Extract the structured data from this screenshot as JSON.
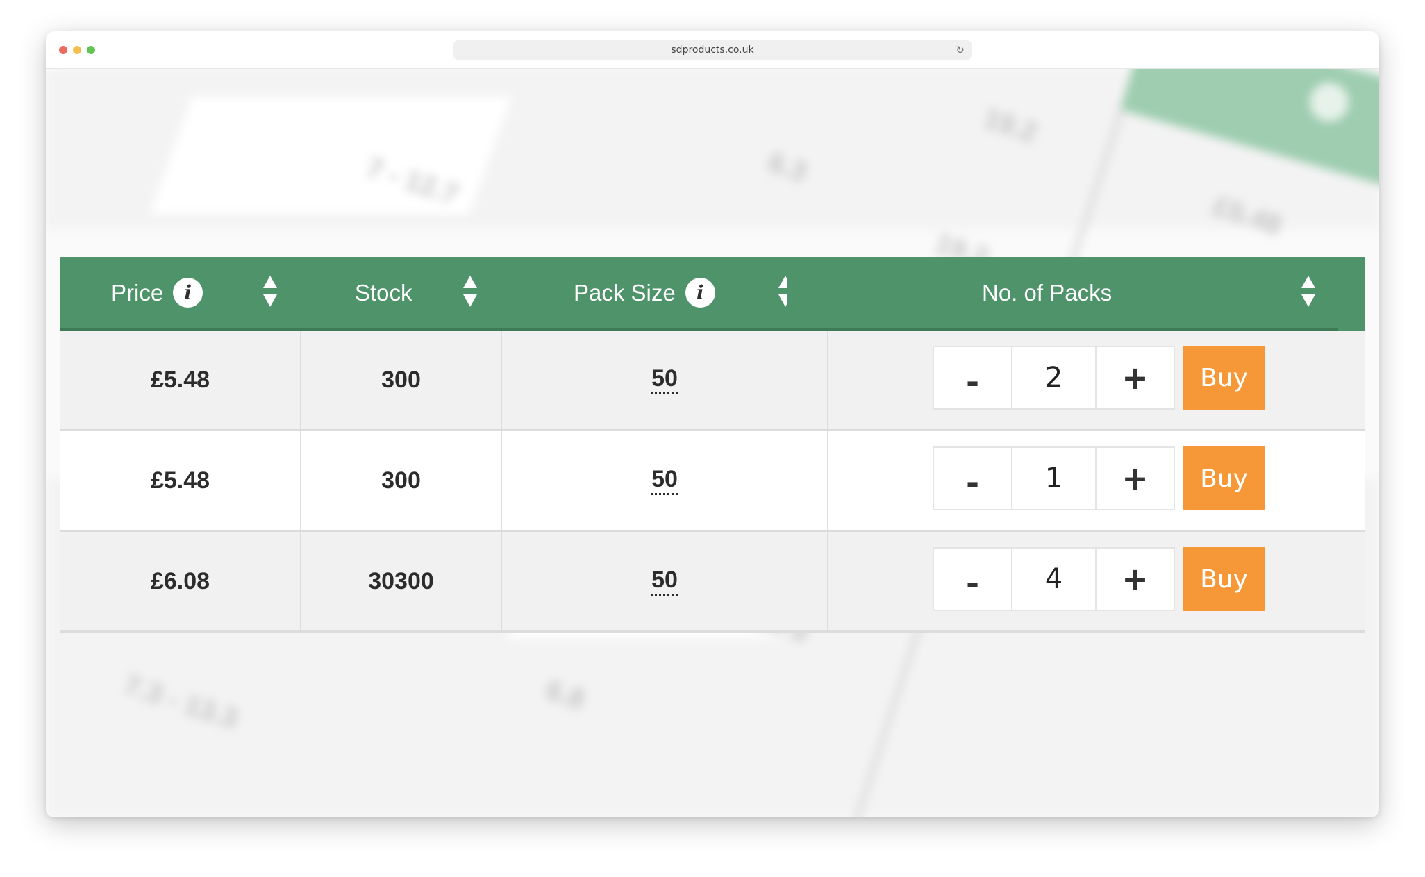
{
  "browser": {
    "url": "sdproducts.co.uk"
  },
  "table": {
    "headers": {
      "price": "Price",
      "stock": "Stock",
      "pack_size": "Pack Size",
      "no_of_packs": "No. of Packs"
    },
    "info_glyph": "i",
    "rows": [
      {
        "price": "£5.48",
        "stock": "300",
        "pack_size": "50",
        "quantity": "2",
        "buy": "Buy",
        "minus": "-",
        "plus": "+"
      },
      {
        "price": "£5.48",
        "stock": "300",
        "pack_size": "50",
        "quantity": "1",
        "buy": "Buy",
        "minus": "-",
        "plus": "+"
      },
      {
        "price": "£6.08",
        "stock": "30300",
        "pack_size": "50",
        "quantity": "4",
        "buy": "Buy",
        "minus": "-",
        "plus": "+"
      }
    ]
  },
  "colors": {
    "header_green": "#4f936b",
    "buy_orange": "#f69838",
    "row_shaded": "#f1f1f1"
  }
}
